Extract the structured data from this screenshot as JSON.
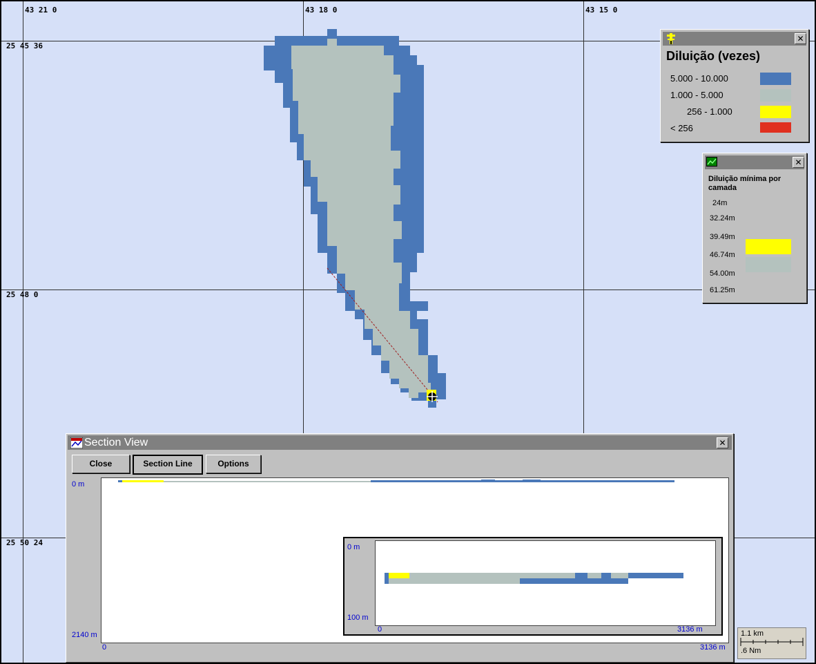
{
  "map": {
    "coordinates": {
      "lon_1": "43 21 0",
      "lon_2": "43 18 0",
      "lon_3": "43 15 0",
      "lat_1": "25 45 36",
      "lat_2": "25 48 0",
      "lat_3": "25 50 24"
    },
    "colors": {
      "water": "#d6e0f8",
      "band_5000_10000": "#4a78b8",
      "band_1000_5000": "#b4c2be",
      "band_256_1000": "#ffff00",
      "band_lt_256": "#e03020"
    },
    "source_marker_icon": "crosshair-target-icon"
  },
  "legend": {
    "title": "Diluição (vezes)",
    "icon": "yellow-tower-icon",
    "items": [
      {
        "label": "5.000 - 10.000",
        "color": "#4a78b8"
      },
      {
        "label": "1.000 - 5.000",
        "color": "#b4c2be"
      },
      {
        "label": "256 - 1.000",
        "color": "#ffff00"
      },
      {
        "label": "< 256",
        "color": "#e03020"
      }
    ]
  },
  "layers": {
    "title": "Diluição mínima por camada",
    "icon": "green-chart-icon",
    "depths": [
      "24m",
      "32.24m",
      "39.49m",
      "46.74m",
      "54.00m",
      "61.25m"
    ],
    "bands": [
      {
        "color": "#ffff00"
      },
      {
        "color": "#b4c2be"
      }
    ]
  },
  "section_view": {
    "title": "Section View",
    "icon": "section-view-icon",
    "buttons": {
      "close": "Close",
      "section_line": "Section Line",
      "options": "Options"
    },
    "main_panel": {
      "top_depth": "0 m",
      "bottom_depth": "2140 m",
      "x_start": "0",
      "x_end": "3136 m"
    },
    "inset_panel": {
      "top_depth": "0 m",
      "bottom_depth": "100 m",
      "x_start": "0",
      "x_end": "3136 m"
    }
  },
  "scale_bar": {
    "km_label": "1.1 km",
    "nm_label": ".6 Nm"
  }
}
